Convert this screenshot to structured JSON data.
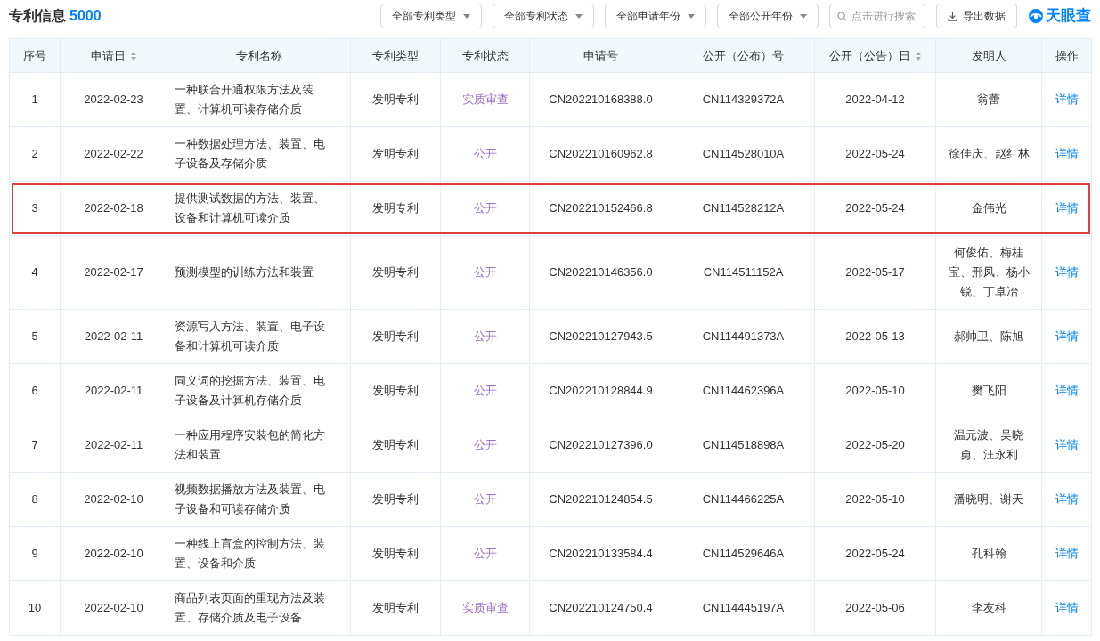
{
  "header": {
    "title": "专利信息",
    "count": "5000",
    "filters": [
      "全部专利类型",
      "全部专利状态",
      "全部申请年份",
      "全部公开年份"
    ],
    "search": {
      "placeholder": "点击进行搜索"
    },
    "export_button": "导出数据",
    "logo": "天眼查"
  },
  "table": {
    "columns": [
      {
        "label": "序号",
        "sortable": false
      },
      {
        "label": "申请日",
        "sortable": true
      },
      {
        "label": "专利名称",
        "sortable": false
      },
      {
        "label": "专利类型",
        "sortable": false
      },
      {
        "label": "专利状态",
        "sortable": false
      },
      {
        "label": "申请号",
        "sortable": false
      },
      {
        "label": "公开（公布）号",
        "sortable": false
      },
      {
        "label": "公开（公告）日",
        "sortable": true
      },
      {
        "label": "发明人",
        "sortable": false
      },
      {
        "label": "操作",
        "sortable": false
      }
    ],
    "rows": [
      {
        "no": "1",
        "date": "2022-02-23",
        "name": "一种联合开通权限方法及装置、计算机可读存储介质",
        "type": "发明专利",
        "status": "实质审查",
        "app_no": "CN202210168388.0",
        "pub_no": "CN114329372A",
        "pub_date": "2022-04-12",
        "inventors": "翁蕾",
        "action": "详情",
        "highlighted": false
      },
      {
        "no": "2",
        "date": "2022-02-22",
        "name": "一种数据处理方法、装置、电子设备及存储介质",
        "type": "发明专利",
        "status": "公开",
        "app_no": "CN202210160962.8",
        "pub_no": "CN114528010A",
        "pub_date": "2022-05-24",
        "inventors": "徐佳庆、赵红林",
        "action": "详情",
        "highlighted": false
      },
      {
        "no": "3",
        "date": "2022-02-18",
        "name": "提供测试数据的方法、装置、设备和计算机可读介质",
        "type": "发明专利",
        "status": "公开",
        "app_no": "CN202210152466.8",
        "pub_no": "CN114528212A",
        "pub_date": "2022-05-24",
        "inventors": "金伟光",
        "action": "详情",
        "highlighted": true
      },
      {
        "no": "4",
        "date": "2022-02-17",
        "name": "预测模型的训练方法和装置",
        "type": "发明专利",
        "status": "公开",
        "app_no": "CN202210146356.0",
        "pub_no": "CN114511152A",
        "pub_date": "2022-05-17",
        "inventors": "何俊佑、梅桂宝、邢凤、杨小锐、丁卓冶",
        "action": "详情",
        "highlighted": false
      },
      {
        "no": "5",
        "date": "2022-02-11",
        "name": "资源写入方法、装置、电子设备和计算机可读介质",
        "type": "发明专利",
        "status": "公开",
        "app_no": "CN202210127943.5",
        "pub_no": "CN114491373A",
        "pub_date": "2022-05-13",
        "inventors": "郝帅卫、陈旭",
        "action": "详情",
        "highlighted": false
      },
      {
        "no": "6",
        "date": "2022-02-11",
        "name": "同义词的挖掘方法、装置、电子设备及计算机存储介质",
        "type": "发明专利",
        "status": "公开",
        "app_no": "CN202210128844.9",
        "pub_no": "CN114462396A",
        "pub_date": "2022-05-10",
        "inventors": "樊飞阳",
        "action": "详情",
        "highlighted": false
      },
      {
        "no": "7",
        "date": "2022-02-11",
        "name": "一种应用程序安装包的简化方法和装置",
        "type": "发明专利",
        "status": "公开",
        "app_no": "CN202210127396.0",
        "pub_no": "CN114518898A",
        "pub_date": "2022-05-20",
        "inventors": "温元波、吴晓勇、汪永利",
        "action": "详情",
        "highlighted": false
      },
      {
        "no": "8",
        "date": "2022-02-10",
        "name": "视频数据播放方法及装置、电子设备和可读存储介质",
        "type": "发明专利",
        "status": "公开",
        "app_no": "CN202210124854.5",
        "pub_no": "CN114466225A",
        "pub_date": "2022-05-10",
        "inventors": "潘晓明、谢天",
        "action": "详情",
        "highlighted": false
      },
      {
        "no": "9",
        "date": "2022-02-10",
        "name": "一种线上盲盒的控制方法、装置、设备和介质",
        "type": "发明专利",
        "status": "公开",
        "app_no": "CN202210133584.4",
        "pub_no": "CN114529646A",
        "pub_date": "2022-05-24",
        "inventors": "孔科翰",
        "action": "详情",
        "highlighted": false
      },
      {
        "no": "10",
        "date": "2022-02-10",
        "name": "商品列表页面的重现方法及装置、存储介质及电子设备",
        "type": "发明专利",
        "status": "实质审查",
        "app_no": "CN202210124750.4",
        "pub_no": "CN114445197A",
        "pub_date": "2022-05-06",
        "inventors": "李友科",
        "action": "详情",
        "highlighted": false
      }
    ]
  }
}
